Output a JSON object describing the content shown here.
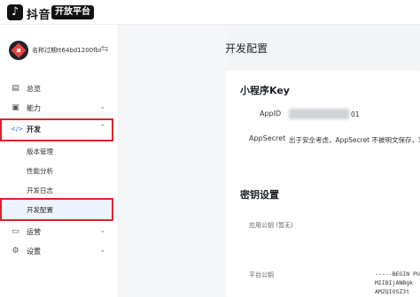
{
  "topbar": {
    "logo_glyph": "♪",
    "brand": "抖音",
    "badge": "开放平台"
  },
  "sidebar": {
    "app_name": "名称过期tt64bd1200fb8...",
    "swap_icon": "⇆",
    "items": [
      {
        "label": "总览",
        "icon": "dashboard-icon",
        "glyph": "▤"
      },
      {
        "label": "能力",
        "icon": "capability-icon",
        "glyph": "▣",
        "chevron": "⌄"
      },
      {
        "label": "开发",
        "icon": "code-icon",
        "glyph": "</>",
        "chevron": "⌃"
      },
      {
        "label": "运营",
        "icon": "operation-icon",
        "glyph": "▭",
        "chevron": "⌄"
      },
      {
        "label": "设置",
        "icon": "settings-icon",
        "glyph": "⚙",
        "chevron": "⌄"
      }
    ],
    "dev_sub": [
      "版本管理",
      "性能分析",
      "开发日志",
      "开发配置"
    ]
  },
  "main": {
    "title": "开发配置",
    "mini_program": {
      "title": "小程序Key",
      "appid_label": "AppID",
      "appid_suffix": "01",
      "appsecret_label": "AppSecret",
      "appsecret_value": "出于安全考虑，AppSecret 不被明文保存，忘记"
    },
    "keys": {
      "title": "密钥设置",
      "app_public_key_label": "应用公钥 (暂无)",
      "platform_public_key_label": "平台公钥",
      "key_lines": [
        "-----BEGIN PU",
        "MIIBIjANBgk",
        "AMZQIOSZ3t"
      ]
    }
  },
  "colors": {
    "highlight": "#d9242e",
    "active_bg": "#eef3ff"
  }
}
